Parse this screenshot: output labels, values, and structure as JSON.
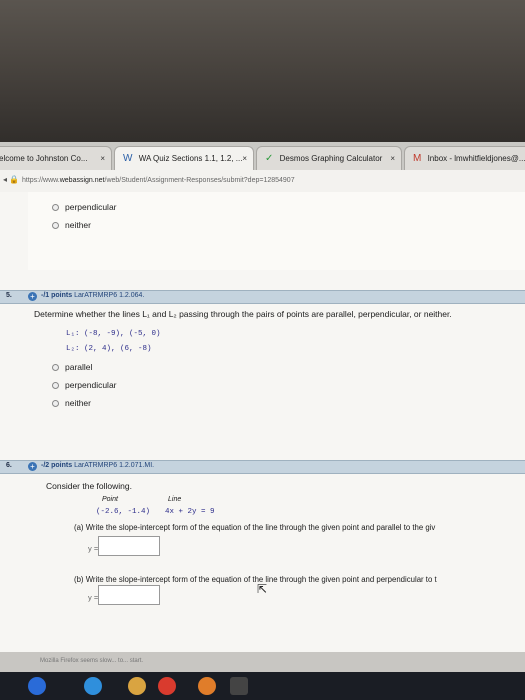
{
  "browser": {
    "tabs": [
      {
        "label": "elcome to Johnston Co...",
        "close": "×"
      },
      {
        "label": "WA Quiz Sections 1.1, 1.2, ...",
        "close": "×"
      },
      {
        "label": "Desmos Graphing Calculator",
        "close": "×"
      },
      {
        "label": "Inbox - lmwhitfieldjones@..."
      }
    ],
    "url_prefix": "https://www.",
    "url_domain": "webassign.net",
    "url_path": "/web/Student/Assignment-Responses/submit?dep=12854907"
  },
  "prev_question": {
    "options": [
      "perpendicular",
      "neither"
    ]
  },
  "q5": {
    "number": "5.",
    "plus": "+",
    "points": "-/1 points",
    "code": "LarATRMRP6 1.2.064.",
    "prompt": "Determine whether the lines L₁ and L₂ passing through the pairs of points are parallel, perpendicular, or neither.",
    "l1": "L₁: (-8, -9), (-5, 0)",
    "l2": "L₂: (2, 4), (6, -8)",
    "options": [
      "parallel",
      "perpendicular",
      "neither"
    ]
  },
  "q6": {
    "number": "6.",
    "plus": "+",
    "points": "-/2 points",
    "code": "LarATRMRP6 1.2.071.MI.",
    "intro": "Consider the following.",
    "col_point": "Point",
    "col_line": "Line",
    "point_value": "(-2.6, -1.4)",
    "line_value": "4x + 2y = 9",
    "part_a": "(a) Write the slope-intercept form of the equation of the line through the given point and parallel to the giv",
    "part_b": "(b) Write the slope-intercept form of the equation of the line through the given point and perpendicular to t",
    "y_label": "y ="
  },
  "status_bar": "Mozilla Firefox seems slow... to... start."
}
